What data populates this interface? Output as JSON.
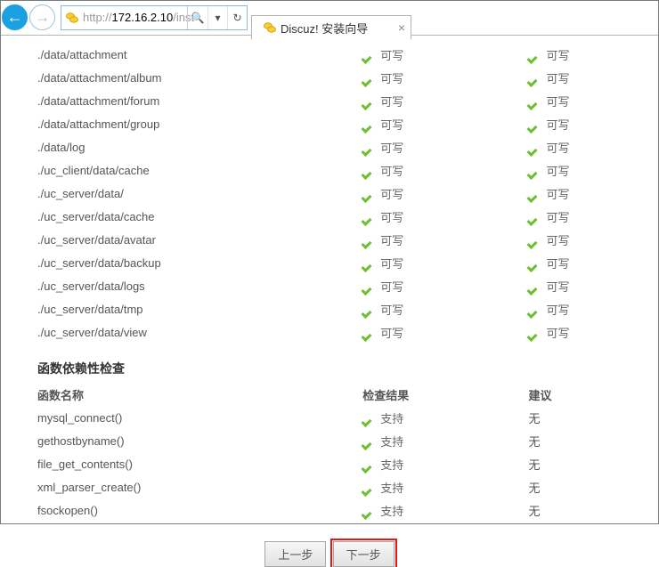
{
  "browser": {
    "url_prefix": "http://",
    "url_ip": "172.16.2.10",
    "url_suffix": "/inst",
    "search_glyph": "🔍",
    "dropdown_glyph": "▾",
    "refresh_glyph": "↻",
    "tab_title": "Discuz! 安装向导",
    "tab_close": "×"
  },
  "perm": {
    "status_label": "可写",
    "rows": [
      {
        "path": "./data/attachment"
      },
      {
        "path": "./data/attachment/album"
      },
      {
        "path": "./data/attachment/forum"
      },
      {
        "path": "./data/attachment/group"
      },
      {
        "path": "./data/log"
      },
      {
        "path": "./uc_client/data/cache"
      },
      {
        "path": "./uc_server/data/"
      },
      {
        "path": "./uc_server/data/cache"
      },
      {
        "path": "./uc_server/data/avatar"
      },
      {
        "path": "./uc_server/data/backup"
      },
      {
        "path": "./uc_server/data/logs"
      },
      {
        "path": "./uc_server/data/tmp"
      },
      {
        "path": "./uc_server/data/view"
      }
    ]
  },
  "func": {
    "section_title": "函数依赖性检查",
    "header_name": "函数名称",
    "header_result": "检查结果",
    "header_suggest": "建议",
    "result_label": "支持",
    "suggest_none": "无",
    "rows": [
      {
        "name": "mysql_connect()"
      },
      {
        "name": "gethostbyname()"
      },
      {
        "name": "file_get_contents()"
      },
      {
        "name": "xml_parser_create()"
      },
      {
        "name": "fsockopen()"
      }
    ]
  },
  "buttons": {
    "prev": "上一步",
    "next": "下一步"
  }
}
